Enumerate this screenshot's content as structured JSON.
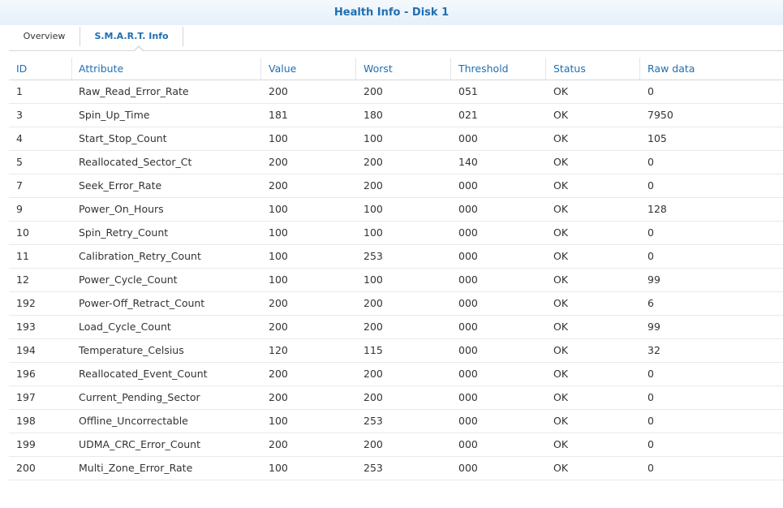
{
  "window": {
    "title": "Health Info - Disk 1"
  },
  "tabs": [
    {
      "label": "Overview",
      "active": false
    },
    {
      "label": "S.M.A.R.T. Info",
      "active": true
    }
  ],
  "colors": {
    "accent": "#1f6fb2",
    "border": "#d4d8dc",
    "text": "#333333"
  },
  "table": {
    "columns": [
      "ID",
      "Attribute",
      "Value",
      "Worst",
      "Threshold",
      "Status",
      "Raw data"
    ],
    "rows": [
      [
        "1",
        "Raw_Read_Error_Rate",
        "200",
        "200",
        "051",
        "OK",
        "0"
      ],
      [
        "3",
        "Spin_Up_Time",
        "181",
        "180",
        "021",
        "OK",
        "7950"
      ],
      [
        "4",
        "Start_Stop_Count",
        "100",
        "100",
        "000",
        "OK",
        "105"
      ],
      [
        "5",
        "Reallocated_Sector_Ct",
        "200",
        "200",
        "140",
        "OK",
        "0"
      ],
      [
        "7",
        "Seek_Error_Rate",
        "200",
        "200",
        "000",
        "OK",
        "0"
      ],
      [
        "9",
        "Power_On_Hours",
        "100",
        "100",
        "000",
        "OK",
        "128"
      ],
      [
        "10",
        "Spin_Retry_Count",
        "100",
        "100",
        "000",
        "OK",
        "0"
      ],
      [
        "11",
        "Calibration_Retry_Count",
        "100",
        "253",
        "000",
        "OK",
        "0"
      ],
      [
        "12",
        "Power_Cycle_Count",
        "100",
        "100",
        "000",
        "OK",
        "99"
      ],
      [
        "192",
        "Power-Off_Retract_Count",
        "200",
        "200",
        "000",
        "OK",
        "6"
      ],
      [
        "193",
        "Load_Cycle_Count",
        "200",
        "200",
        "000",
        "OK",
        "99"
      ],
      [
        "194",
        "Temperature_Celsius",
        "120",
        "115",
        "000",
        "OK",
        "32"
      ],
      [
        "196",
        "Reallocated_Event_Count",
        "200",
        "200",
        "000",
        "OK",
        "0"
      ],
      [
        "197",
        "Current_Pending_Sector",
        "200",
        "200",
        "000",
        "OK",
        "0"
      ],
      [
        "198",
        "Offline_Uncorrectable",
        "100",
        "253",
        "000",
        "OK",
        "0"
      ],
      [
        "199",
        "UDMA_CRC_Error_Count",
        "200",
        "200",
        "000",
        "OK",
        "0"
      ],
      [
        "200",
        "Multi_Zone_Error_Rate",
        "100",
        "253",
        "000",
        "OK",
        "0"
      ]
    ]
  }
}
